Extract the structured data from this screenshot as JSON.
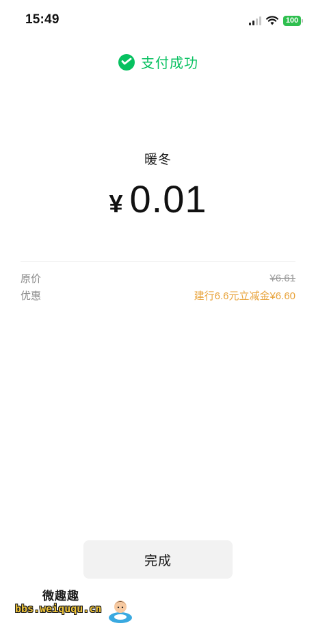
{
  "status_bar": {
    "time": "15:49",
    "battery": "100",
    "icons": [
      "cellular-signal-icon",
      "wifi-icon",
      "battery-icon"
    ]
  },
  "header": {
    "title": "支付成功",
    "icon": "wechat-pay-icon",
    "accent_color": "#07c160"
  },
  "payment": {
    "merchant": "暖冬",
    "currency_symbol": "¥",
    "amount": "0.01"
  },
  "details": {
    "original_price_label": "原价",
    "original_price_value": "¥6.61",
    "discount_label": "优惠",
    "discount_value": "建行6.6元立减金¥6.60",
    "discount_color": "#e8a33b"
  },
  "actions": {
    "done_label": "完成"
  },
  "watermark": {
    "title": "微趣趣",
    "url": "bbs.weiququ.cn"
  }
}
